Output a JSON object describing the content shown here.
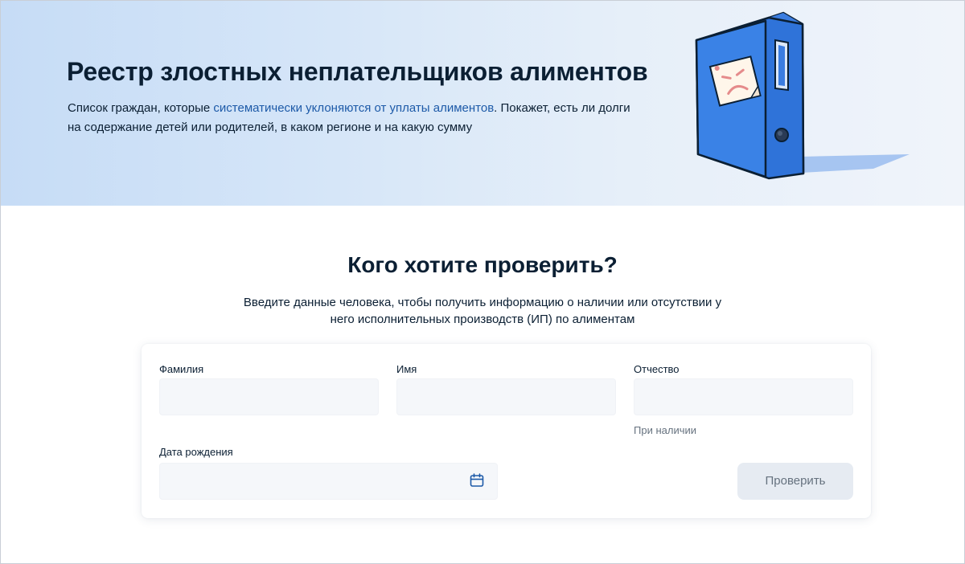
{
  "hero": {
    "title": "Реестр злостных неплательщиков алиментов",
    "desc_before": "Список граждан, которые ",
    "desc_link": "систематически уклоняются от уплаты алиментов",
    "desc_after": ". Покажет, есть ли долги на содержание детей или родителей, в каком регионе и на какую сумму",
    "illustration": "blue-binder-with-sad-sticky-note"
  },
  "section": {
    "title": "Кого хотите проверить?",
    "subtitle": "Введите данные человека, чтобы получить информацию о наличии или отсутствии у него исполнительных производств (ИП) по алиментам"
  },
  "form": {
    "surname_label": "Фамилия",
    "surname_value": "",
    "name_label": "Имя",
    "name_value": "",
    "patronymic_label": "Отчество",
    "patronymic_value": "",
    "patronymic_hint": "При наличии",
    "birthdate_label": "Дата рождения",
    "birthdate_value": "",
    "calendar_icon": "calendar-icon",
    "submit_label": "Проверить"
  },
  "colors": {
    "hero_gradient_start": "#c6dcf6",
    "hero_gradient_end": "#f0f4fa",
    "link": "#1d5aa8",
    "field_bg": "#f5f7fa",
    "button_disabled_bg": "#e6ebf2",
    "text_dark": "#0b1f33"
  }
}
